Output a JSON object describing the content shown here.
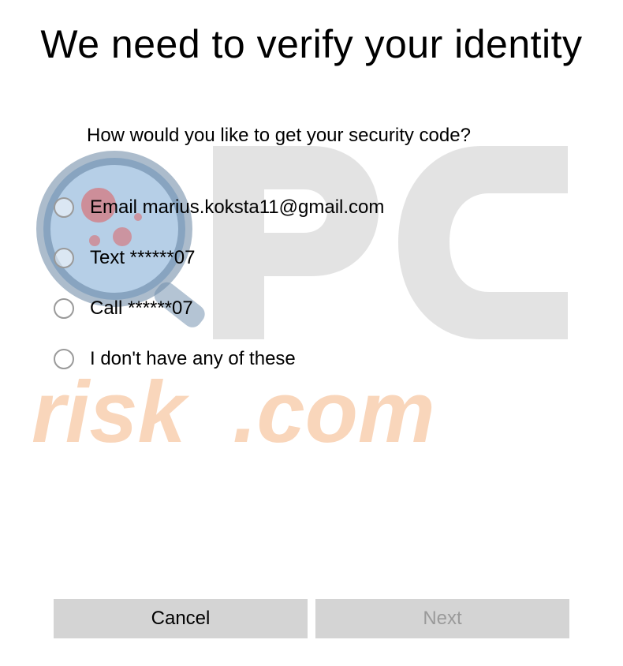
{
  "heading": "We need to verify your identity",
  "question": "How would you like to get your security code?",
  "options": [
    {
      "label": "Email marius.koksta11@gmail.com"
    },
    {
      "label": "Text ******07"
    },
    {
      "label": "Call ******07"
    },
    {
      "label": "I don't have any of these"
    }
  ],
  "buttons": {
    "cancel": "Cancel",
    "next": "Next"
  }
}
